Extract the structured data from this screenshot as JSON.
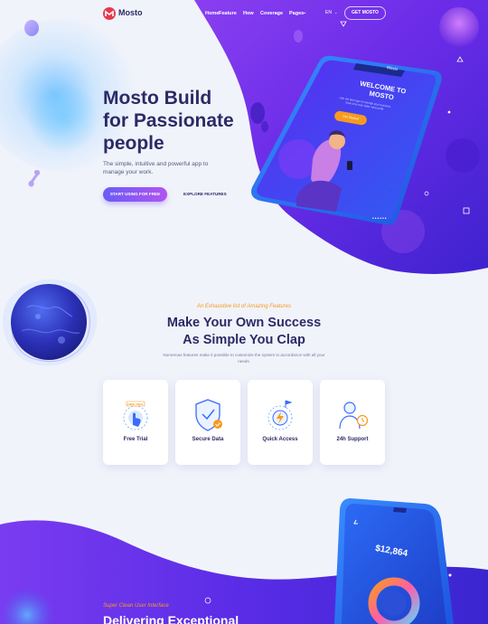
{
  "header": {
    "brand": "Mosto",
    "nav": [
      "Home",
      "Feature",
      "How",
      "Coverage",
      "Pages"
    ],
    "language": "EN",
    "cta": "GET MOSTO"
  },
  "hero": {
    "title_lines": [
      "Mosto Build",
      "for Passionate",
      "people"
    ],
    "subtitle": "The simple, intuitive and powerful app to manage your work.",
    "primary_button": "START USING FOR FREE",
    "secondary_link": "EXPLORE FEATURES",
    "phone_screen": {
      "brand": "Mosto",
      "welcome": "WELCOME TO MOSTO",
      "description": "Join the best app to manage your business. Save time and make more profit.",
      "button": "Get Started"
    }
  },
  "features": {
    "tag": "An Exhaustive list of Amazing Features",
    "title_lines": [
      "Make Your Own Success",
      "As Simple You Clap"
    ],
    "subtitle": "Numerous features make it possible to customize the system in accordance with all your needs.",
    "cards": [
      {
        "label": "Free Trial",
        "icon": "free-trial-icon",
        "badge": "FREE TRIAL"
      },
      {
        "label": "Secure Data",
        "icon": "shield-check-icon"
      },
      {
        "label": "Quick Access",
        "icon": "quick-access-icon"
      },
      {
        "label": "24h Support",
        "icon": "support-agent-icon"
      }
    ]
  },
  "bottom": {
    "tag": "Super Clean User Interface",
    "title": "Delivering Exceptional",
    "phone_amount": "$12,864"
  },
  "colors": {
    "navy": "#2c2a66",
    "purple": "#6a2cf0",
    "accent_orange": "#f79a1e",
    "blue": "#3b6bff"
  }
}
